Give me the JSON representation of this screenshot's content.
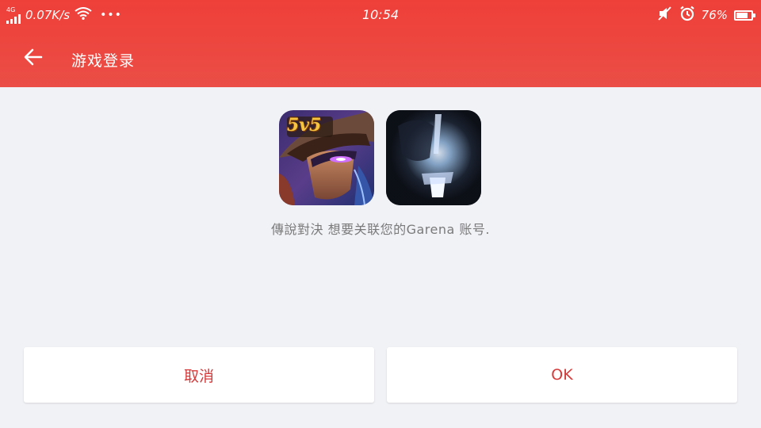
{
  "status_bar": {
    "network_type": "4G",
    "speed": "0.07K/s",
    "more": "•••",
    "time": "10:54",
    "battery_percent": "76%",
    "battery_level": 0.76,
    "icons": [
      "signal-icon",
      "wifi-icon",
      "mute-icon",
      "alarm-icon",
      "battery-icon"
    ]
  },
  "toolbar": {
    "title": "游戏登录",
    "back_icon": "arrow-left-icon"
  },
  "content": {
    "app_icons": [
      {
        "name": "game-icon",
        "badge": "5v5"
      },
      {
        "name": "account-icon"
      }
    ],
    "message": "傳說對決 想要关联您的Garena 账号."
  },
  "actions": {
    "cancel_label": "取消",
    "ok_label": "OK"
  },
  "colors": {
    "header": "#ef3f39",
    "background": "#f1f2f6",
    "button_text": "#d63a3a"
  }
}
